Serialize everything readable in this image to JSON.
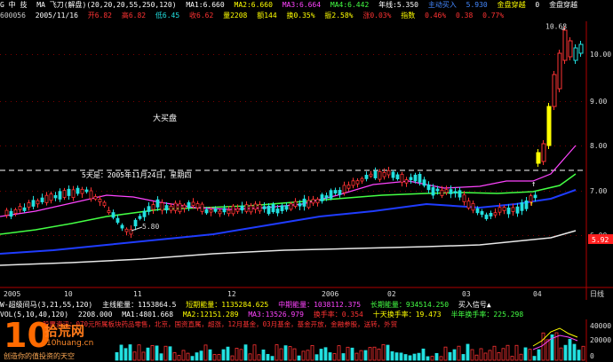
{
  "header": {
    "stock_code_label": "G 中 技",
    "indicator_title": "MA 飞刀(解盘)(20,20,20,55,250,120)",
    "ma1": "MA1:6.660",
    "ma2": "MA2:6.660",
    "ma3": "MA3:6.664",
    "ma4": "MA4:6.442",
    "year_line": "年线:5.350",
    "signal1": "主动买入",
    "signal1_value": "5.930",
    "signal2": "金盘穿越",
    "signal2_value": "0",
    "signal3": "金盘穿越"
  },
  "info": {
    "code": "600056",
    "date": "2005/11/16",
    "open": "开6.82",
    "high": "高6.82",
    "low": "低6.45",
    "close": "收6.62",
    "volume": "量2208",
    "amount": "额144",
    "turnover": "换0.35%",
    "amplitude": "振2.58%",
    "pct": "涨0.03%",
    "index": "指数",
    "index_value": "0.46%",
    "extra": "0.38",
    "extra2": "0.77%"
  },
  "chart": {
    "price_high_label": "10.68",
    "price_low_label": "5.80",
    "last_price_badge": "5.92",
    "annotation_dadan": "大买盘",
    "annotation_date": "5天是：2005年11月24日，星期四",
    "y_ticks": [
      "10.00",
      "9.00",
      "8.00",
      "7.00",
      "6.00"
    ],
    "x_ticks": [
      "2005",
      "10",
      "11",
      "12",
      "2006",
      "02",
      "03",
      "04"
    ],
    "x_axis_right_label": "日线"
  },
  "energy_bar": {
    "label": "W-超级间马(3,21,55,120)",
    "main": "主线能量：1153864.5",
    "short": "短期能量：1135284.625",
    "mid": "中期能量：1038112.375",
    "long": "长期能量：934514.250",
    "buy": "买入信号▲"
  },
  "volume_bar": {
    "label": "VOL(5,10,40,120)",
    "vol": "2208.000",
    "ma1": "MA1:4801.668",
    "ma2": "MA2:12151.289",
    "ma3": "MA3:13526.979",
    "turn1": "换手率：0.354",
    "turn2": "十天换手率：19.473",
    "turn3": "半年换手率：225.298"
  },
  "news_line": "股票资讯：070元所属板块药品零售，北京，国资直属，超涨，12月基金，03月基金，基金开放，金融参股，送转，外贸",
  "volume_axis": [
    "40000",
    "20000",
    "0"
  ],
  "watermark": {
    "number": "10",
    "chinese": "拾荒网",
    "url": "10huang.cn",
    "sub": "创造你的值投资的天空"
  },
  "colors": {
    "up": "#ff3333",
    "down": "#22e0e0",
    "ma_short": "#ffffff",
    "ma_mid": "#44ff44",
    "ma_long": "#ff44ff",
    "ma_blue": "#1f3cff",
    "ma_year": "#e8e8e8",
    "special": "#ffff00"
  }
}
